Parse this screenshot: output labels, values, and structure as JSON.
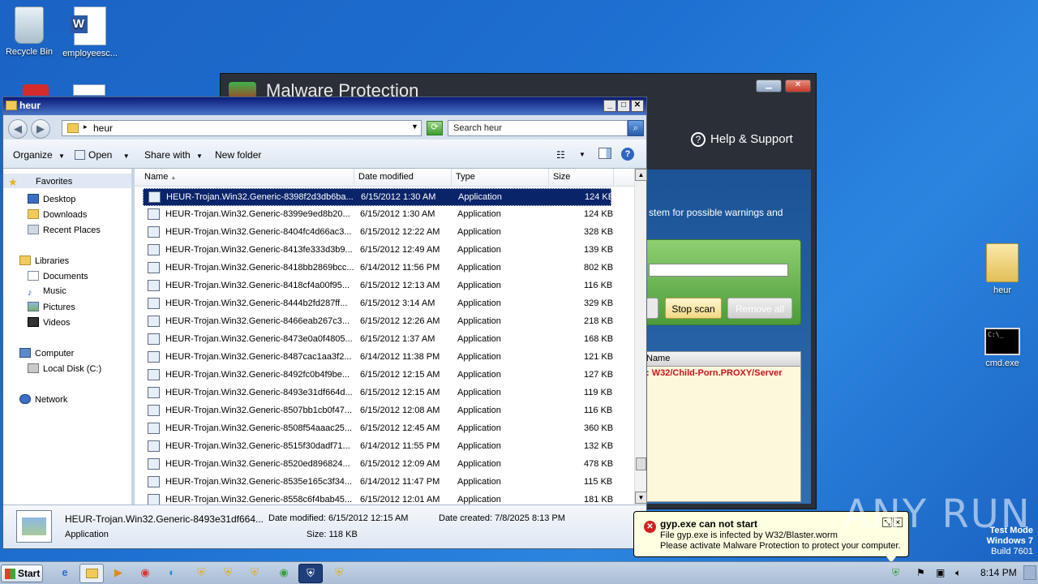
{
  "desktop": {
    "icons": [
      {
        "label": "Recycle Bin"
      },
      {
        "label": "employeesc..."
      },
      {
        "label": "heur"
      },
      {
        "label": "cmd.exe"
      }
    ]
  },
  "malware_window": {
    "title": "Malware Protection",
    "help": "Help & Support",
    "scan_text": "stem for possible warnings and",
    "stop_scan": "Stop scan",
    "remove_all": "Remove all",
    "column_name": "Name",
    "threat": ": W32/Child-Porn.PROXY/Server",
    "close_icon": "close-icon",
    "minimize_icon": "minimize-icon"
  },
  "explorer": {
    "title": "heur",
    "address": "heur",
    "search_placeholder": "Search heur",
    "commands": {
      "organize": "Organize",
      "open": "Open",
      "share": "Share with",
      "newfolder": "New folder"
    },
    "nav": {
      "favorites": "Favorites",
      "desktop": "Desktop",
      "downloads": "Downloads",
      "recent": "Recent Places",
      "libraries": "Libraries",
      "documents": "Documents",
      "music": "Music",
      "pictures": "Pictures",
      "videos": "Videos",
      "computer": "Computer",
      "localdisk": "Local Disk (C:)",
      "network": "Network"
    },
    "columns": {
      "name": "Name",
      "date": "Date modified",
      "type": "Type",
      "size": "Size"
    },
    "files": [
      {
        "name": "HEUR-Trojan.Win32.Generic-8398f2d3db6ba...",
        "date": "6/15/2012 1:30 AM",
        "type": "Application",
        "size": "124 KB"
      },
      {
        "name": "HEUR-Trojan.Win32.Generic-8399e9ed8b20...",
        "date": "6/15/2012 1:30 AM",
        "type": "Application",
        "size": "124 KB"
      },
      {
        "name": "HEUR-Trojan.Win32.Generic-8404fc4d66ac3...",
        "date": "6/15/2012 12:22 AM",
        "type": "Application",
        "size": "328 KB"
      },
      {
        "name": "HEUR-Trojan.Win32.Generic-8413fe333d3b9...",
        "date": "6/15/2012 12:49 AM",
        "type": "Application",
        "size": "139 KB"
      },
      {
        "name": "HEUR-Trojan.Win32.Generic-8418bb2869bcc...",
        "date": "6/14/2012 11:56 PM",
        "type": "Application",
        "size": "802 KB"
      },
      {
        "name": "HEUR-Trojan.Win32.Generic-8418cf4a00f95...",
        "date": "6/15/2012 12:13 AM",
        "type": "Application",
        "size": "116 KB"
      },
      {
        "name": "HEUR-Trojan.Win32.Generic-8444b2fd287ff...",
        "date": "6/15/2012 3:14 AM",
        "type": "Application",
        "size": "329 KB"
      },
      {
        "name": "HEUR-Trojan.Win32.Generic-8466eab267c3...",
        "date": "6/15/2012 12:26 AM",
        "type": "Application",
        "size": "218 KB"
      },
      {
        "name": "HEUR-Trojan.Win32.Generic-8473e0a0f4805...",
        "date": "6/15/2012 1:37 AM",
        "type": "Application",
        "size": "168 KB"
      },
      {
        "name": "HEUR-Trojan.Win32.Generic-8487cac1aa3f2...",
        "date": "6/14/2012 11:38 PM",
        "type": "Application",
        "size": "121 KB"
      },
      {
        "name": "HEUR-Trojan.Win32.Generic-8492fc0b4f9be...",
        "date": "6/15/2012 12:15 AM",
        "type": "Application",
        "size": "127 KB"
      },
      {
        "name": "HEUR-Trojan.Win32.Generic-8493e31df664d...",
        "date": "6/15/2012 12:15 AM",
        "type": "Application",
        "size": "119 KB"
      },
      {
        "name": "HEUR-Trojan.Win32.Generic-8507bb1cb0f47...",
        "date": "6/15/2012 12:08 AM",
        "type": "Application",
        "size": "116 KB"
      },
      {
        "name": "HEUR-Trojan.Win32.Generic-8508f54aaac25...",
        "date": "6/15/2012 12:45 AM",
        "type": "Application",
        "size": "360 KB"
      },
      {
        "name": "HEUR-Trojan.Win32.Generic-8515f30dadf71...",
        "date": "6/14/2012 11:55 PM",
        "type": "Application",
        "size": "132 KB"
      },
      {
        "name": "HEUR-Trojan.Win32.Generic-8520ed896824...",
        "date": "6/15/2012 12:09 AM",
        "type": "Application",
        "size": "478 KB"
      },
      {
        "name": "HEUR-Trojan.Win32.Generic-8535e165c3f34...",
        "date": "6/14/2012 11:47 PM",
        "type": "Application",
        "size": "115 KB"
      },
      {
        "name": "HEUR-Trojan.Win32.Generic-8558c6f4bab45...",
        "date": "6/15/2012 12:01 AM",
        "type": "Application",
        "size": "181 KB"
      }
    ],
    "details": {
      "name": "HEUR-Trojan.Win32.Generic-8493e31df664...",
      "modified": "Date modified: 6/15/2012 12:15 AM",
      "created": "Date created: 7/8/2025 8:13 PM",
      "type": "Application",
      "size": "Size: 118 KB"
    }
  },
  "balloon": {
    "title": "gyp.exe can not start",
    "line1": "File gyp.exe is infected by W32/Blaster.worm",
    "line2": "Please activate Malware Protection to protect your computer."
  },
  "watermark": "ANY RUN",
  "testmode": {
    "l1": "Test Mode",
    "l2": "Windows 7",
    "l3": "Build 7601"
  },
  "taskbar": {
    "start": "Start",
    "clock": "8:14 PM"
  }
}
